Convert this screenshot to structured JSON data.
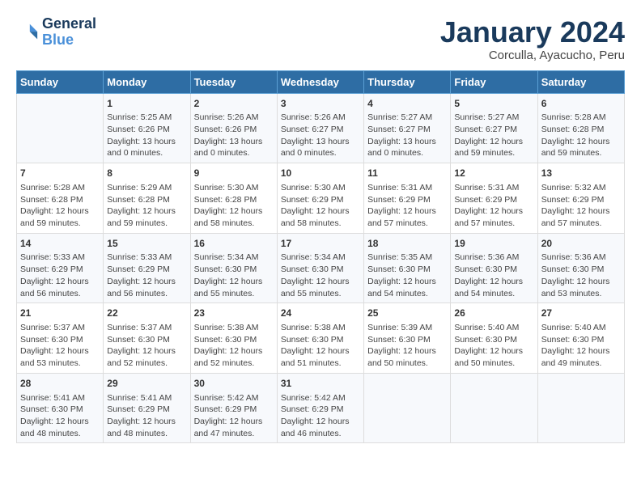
{
  "header": {
    "logo_line1": "General",
    "logo_line2": "Blue",
    "title": "January 2024",
    "subtitle": "Corculla, Ayacucho, Peru"
  },
  "columns": [
    "Sunday",
    "Monday",
    "Tuesday",
    "Wednesday",
    "Thursday",
    "Friday",
    "Saturday"
  ],
  "weeks": [
    [
      {
        "day": "",
        "content": ""
      },
      {
        "day": "1",
        "content": "Sunrise: 5:25 AM\nSunset: 6:26 PM\nDaylight: 13 hours\nand 0 minutes."
      },
      {
        "day": "2",
        "content": "Sunrise: 5:26 AM\nSunset: 6:26 PM\nDaylight: 13 hours\nand 0 minutes."
      },
      {
        "day": "3",
        "content": "Sunrise: 5:26 AM\nSunset: 6:27 PM\nDaylight: 13 hours\nand 0 minutes."
      },
      {
        "day": "4",
        "content": "Sunrise: 5:27 AM\nSunset: 6:27 PM\nDaylight: 13 hours\nand 0 minutes."
      },
      {
        "day": "5",
        "content": "Sunrise: 5:27 AM\nSunset: 6:27 PM\nDaylight: 12 hours\nand 59 minutes."
      },
      {
        "day": "6",
        "content": "Sunrise: 5:28 AM\nSunset: 6:28 PM\nDaylight: 12 hours\nand 59 minutes."
      }
    ],
    [
      {
        "day": "7",
        "content": "Sunrise: 5:28 AM\nSunset: 6:28 PM\nDaylight: 12 hours\nand 59 minutes."
      },
      {
        "day": "8",
        "content": "Sunrise: 5:29 AM\nSunset: 6:28 PM\nDaylight: 12 hours\nand 59 minutes."
      },
      {
        "day": "9",
        "content": "Sunrise: 5:30 AM\nSunset: 6:28 PM\nDaylight: 12 hours\nand 58 minutes."
      },
      {
        "day": "10",
        "content": "Sunrise: 5:30 AM\nSunset: 6:29 PM\nDaylight: 12 hours\nand 58 minutes."
      },
      {
        "day": "11",
        "content": "Sunrise: 5:31 AM\nSunset: 6:29 PM\nDaylight: 12 hours\nand 57 minutes."
      },
      {
        "day": "12",
        "content": "Sunrise: 5:31 AM\nSunset: 6:29 PM\nDaylight: 12 hours\nand 57 minutes."
      },
      {
        "day": "13",
        "content": "Sunrise: 5:32 AM\nSunset: 6:29 PM\nDaylight: 12 hours\nand 57 minutes."
      }
    ],
    [
      {
        "day": "14",
        "content": "Sunrise: 5:33 AM\nSunset: 6:29 PM\nDaylight: 12 hours\nand 56 minutes."
      },
      {
        "day": "15",
        "content": "Sunrise: 5:33 AM\nSunset: 6:29 PM\nDaylight: 12 hours\nand 56 minutes."
      },
      {
        "day": "16",
        "content": "Sunrise: 5:34 AM\nSunset: 6:30 PM\nDaylight: 12 hours\nand 55 minutes."
      },
      {
        "day": "17",
        "content": "Sunrise: 5:34 AM\nSunset: 6:30 PM\nDaylight: 12 hours\nand 55 minutes."
      },
      {
        "day": "18",
        "content": "Sunrise: 5:35 AM\nSunset: 6:30 PM\nDaylight: 12 hours\nand 54 minutes."
      },
      {
        "day": "19",
        "content": "Sunrise: 5:36 AM\nSunset: 6:30 PM\nDaylight: 12 hours\nand 54 minutes."
      },
      {
        "day": "20",
        "content": "Sunrise: 5:36 AM\nSunset: 6:30 PM\nDaylight: 12 hours\nand 53 minutes."
      }
    ],
    [
      {
        "day": "21",
        "content": "Sunrise: 5:37 AM\nSunset: 6:30 PM\nDaylight: 12 hours\nand 53 minutes."
      },
      {
        "day": "22",
        "content": "Sunrise: 5:37 AM\nSunset: 6:30 PM\nDaylight: 12 hours\nand 52 minutes."
      },
      {
        "day": "23",
        "content": "Sunrise: 5:38 AM\nSunset: 6:30 PM\nDaylight: 12 hours\nand 52 minutes."
      },
      {
        "day": "24",
        "content": "Sunrise: 5:38 AM\nSunset: 6:30 PM\nDaylight: 12 hours\nand 51 minutes."
      },
      {
        "day": "25",
        "content": "Sunrise: 5:39 AM\nSunset: 6:30 PM\nDaylight: 12 hours\nand 50 minutes."
      },
      {
        "day": "26",
        "content": "Sunrise: 5:40 AM\nSunset: 6:30 PM\nDaylight: 12 hours\nand 50 minutes."
      },
      {
        "day": "27",
        "content": "Sunrise: 5:40 AM\nSunset: 6:30 PM\nDaylight: 12 hours\nand 49 minutes."
      }
    ],
    [
      {
        "day": "28",
        "content": "Sunrise: 5:41 AM\nSunset: 6:30 PM\nDaylight: 12 hours\nand 48 minutes."
      },
      {
        "day": "29",
        "content": "Sunrise: 5:41 AM\nSunset: 6:29 PM\nDaylight: 12 hours\nand 48 minutes."
      },
      {
        "day": "30",
        "content": "Sunrise: 5:42 AM\nSunset: 6:29 PM\nDaylight: 12 hours\nand 47 minutes."
      },
      {
        "day": "31",
        "content": "Sunrise: 5:42 AM\nSunset: 6:29 PM\nDaylight: 12 hours\nand 46 minutes."
      },
      {
        "day": "",
        "content": ""
      },
      {
        "day": "",
        "content": ""
      },
      {
        "day": "",
        "content": ""
      }
    ]
  ]
}
